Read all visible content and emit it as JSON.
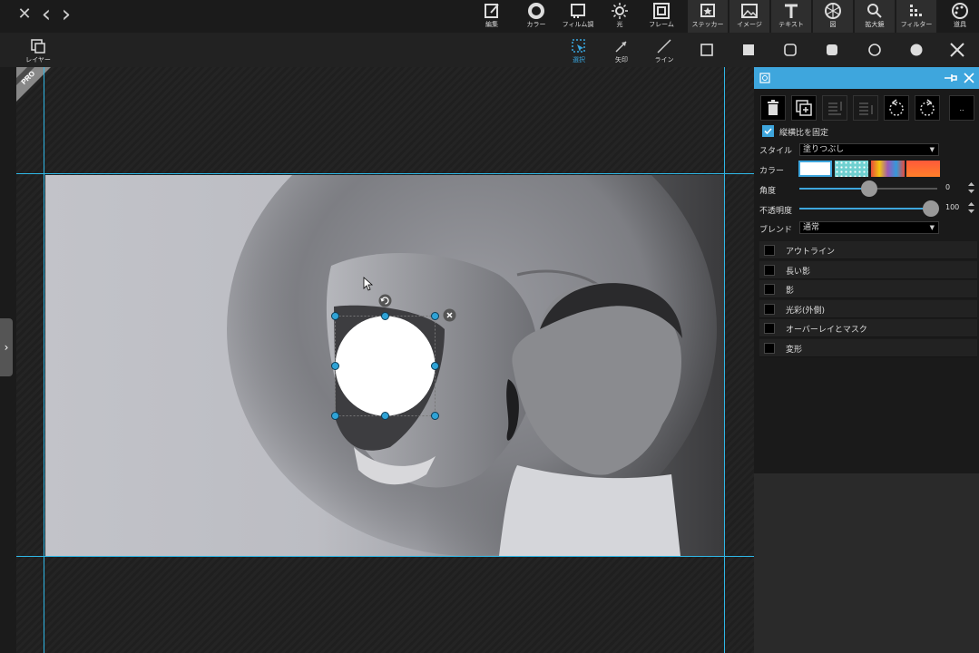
{
  "nav": {
    "close": "✕",
    "back": "‹",
    "forward": "›"
  },
  "top_tools": [
    {
      "label": "編集",
      "icon": "edit-icon"
    },
    {
      "label": "カラー",
      "icon": "color-icon"
    },
    {
      "label": "フィルム調",
      "icon": "film-icon"
    },
    {
      "label": "光",
      "icon": "light-icon"
    },
    {
      "label": "フレーム",
      "icon": "frame-icon"
    },
    {
      "label": "ステッカー",
      "icon": "sticker-icon"
    },
    {
      "label": "イメージ",
      "icon": "image-icon"
    },
    {
      "label": "テキスト",
      "icon": "text-icon"
    },
    {
      "label": "図",
      "icon": "shape-icon"
    },
    {
      "label": "拡大鏡",
      "icon": "magnifier-icon"
    },
    {
      "label": "フィルター",
      "icon": "filter-icon"
    },
    {
      "label": "道具",
      "icon": "tools-icon"
    }
  ],
  "second_tools": {
    "layers": "レイヤー",
    "select": "選択",
    "arrow": "矢印",
    "line": "ライン"
  },
  "badge": {
    "text": "PRO"
  },
  "panel": {
    "keep_ratio_label": "縦横比を固定",
    "keep_ratio_checked": true,
    "more_label": "..",
    "style_label": "スタイル",
    "style_value": "塗りつぶし",
    "color_label": "カラー",
    "angle_label": "角度",
    "angle_value": "0",
    "opacity_label": "不透明度",
    "opacity_value": "100",
    "blend_label": "ブレンド",
    "blend_value": "通常",
    "options": [
      {
        "label": "アウトライン",
        "checked": false
      },
      {
        "label": "長い影",
        "checked": false
      },
      {
        "label": "影",
        "checked": false
      },
      {
        "label": "光彩(外側)",
        "checked": false
      },
      {
        "label": "オーバーレイとマスク",
        "checked": false
      },
      {
        "label": "変形",
        "checked": false
      }
    ]
  },
  "colors": {
    "accent": "#3ea6dd",
    "guide": "#2fb7e6",
    "handle": "#2fa3d6"
  }
}
